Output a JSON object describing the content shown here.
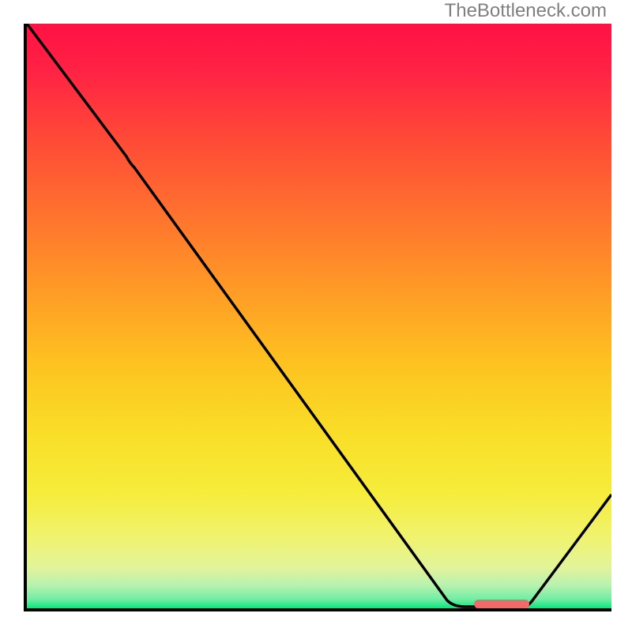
{
  "attribution": "TheBottleneck.com",
  "chart_data": {
    "type": "line",
    "xlim": [
      0,
      100
    ],
    "ylim": [
      0,
      100
    ],
    "xlabel": "",
    "ylabel": "",
    "title": "",
    "grid": false,
    "gradient_bands": {
      "description": "Vertical color gradient behind the curve: red at top, yellow middle, green at bottom",
      "stops": [
        {
          "pos": 0,
          "color": "#FF1144"
        },
        {
          "pos": 25,
          "color": "#FF5533"
        },
        {
          "pos": 50,
          "color": "#FFAA22"
        },
        {
          "pos": 75,
          "color": "#F5E533"
        },
        {
          "pos": 92,
          "color": "#E8F088"
        },
        {
          "pos": 100,
          "color": "#05E87C"
        }
      ]
    },
    "series": [
      {
        "name": "bottleneck-curve",
        "description": "Black V-shaped curve starting top-left, dipping to minimum around x≈80, rising to right edge",
        "points": [
          {
            "x": 0,
            "y": 100
          },
          {
            "x": 17,
            "y": 77
          },
          {
            "x": 72,
            "y": 1
          },
          {
            "x": 77,
            "y": 0
          },
          {
            "x": 85,
            "y": 0
          },
          {
            "x": 100,
            "y": 20
          }
        ]
      }
    ],
    "marker": {
      "name": "optimal-range",
      "x_start": 77,
      "x_end": 86,
      "y": 0.5,
      "color": "#F16A6A"
    }
  }
}
